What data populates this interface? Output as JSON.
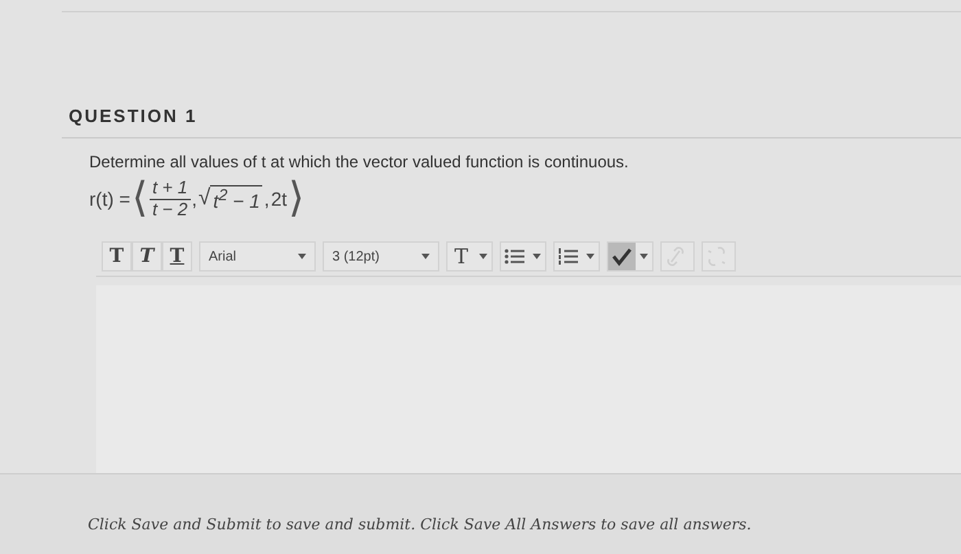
{
  "question": {
    "title": "QUESTION 1",
    "prompt": "Determine all values of t at which the vector valued function is continuous.",
    "formula": {
      "lhs": "r(t) =",
      "open": "⟨",
      "numerator": "t + 1",
      "denominator": "t − 2",
      "sep1": ",",
      "radical": "√",
      "radicand": "t$^{2}$ − 1",
      "sep2": ",",
      "last": "2t",
      "close": "⟩"
    }
  },
  "toolbar": {
    "styles": [
      {
        "label": "T",
        "kind": "bold"
      },
      {
        "label": "T",
        "kind": "italic"
      },
      {
        "label": "T",
        "kind": "underline"
      }
    ],
    "font": "Arial",
    "size": "3 (12pt)",
    "tools": [
      {
        "kind": "text-color",
        "label": "T",
        "selected": false,
        "disabled": false
      },
      {
        "kind": "bullets",
        "selected": false,
        "disabled": false
      },
      {
        "kind": "numbering",
        "selected": false,
        "disabled": false
      },
      {
        "kind": "spellcheck",
        "selected": true,
        "disabled": false
      },
      {
        "kind": "link",
        "selected": false,
        "disabled": true
      },
      {
        "kind": "unlink",
        "selected": false,
        "disabled": true
      }
    ]
  },
  "footer": "Click Save and Submit to save and submit. Click Save All Answers to save all answers."
}
